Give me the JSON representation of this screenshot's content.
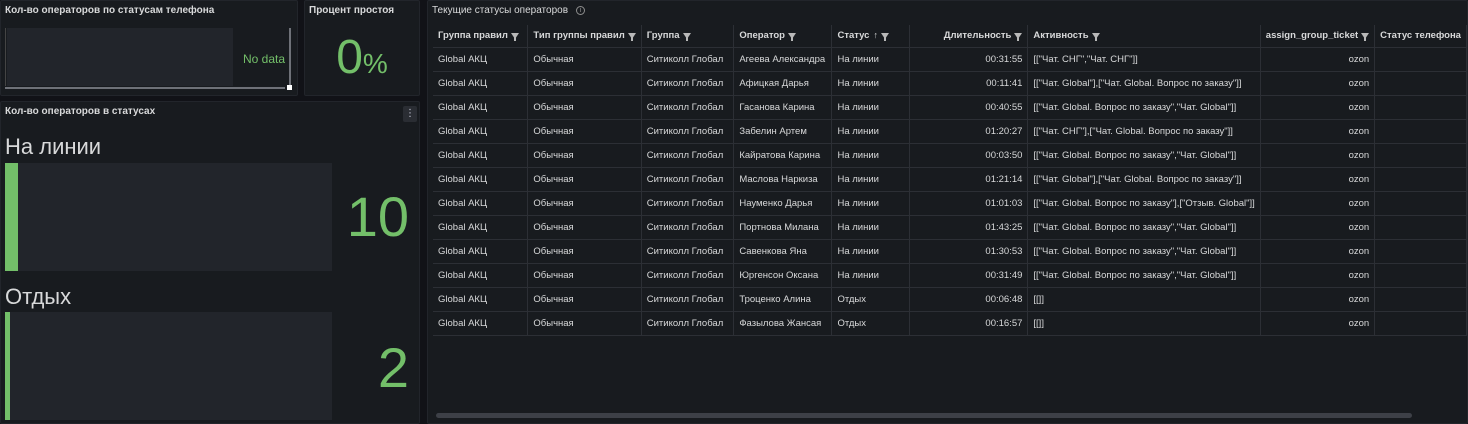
{
  "panels": {
    "phone_status": {
      "title": "Кол-во операторов по статусам телефона",
      "no_data": "No data"
    },
    "idle_percent": {
      "title": "Процент простоя",
      "value": "0",
      "unit": "%"
    },
    "status_counts": {
      "title": "Кол-во операторов в статусах",
      "menu_icon": "⋮",
      "items": [
        {
          "name": "На линии",
          "value": "10",
          "fraction": 0.04
        },
        {
          "name": "Отдых",
          "value": "2",
          "fraction": 0.006
        }
      ]
    },
    "table": {
      "title": "Текущие статусы операторов",
      "info_icon": "i",
      "sort_indicator": "↑",
      "columns": [
        "Группа правил",
        "Тип группы правил",
        "Группа",
        "Оператор",
        "Статус",
        "Длительность",
        "Активность",
        "assign_group_ticket",
        "Статус телефона"
      ],
      "rows": [
        [
          "Global АКЦ",
          "Обычная",
          "Ситиколл Глобал",
          "Агеева Александра",
          "На линии",
          "00:31:55",
          "[[\"Чат. СНГ\",\"Чат. СНГ\"]]",
          "ozon",
          ""
        ],
        [
          "Global АКЦ",
          "Обычная",
          "Ситиколл Глобал",
          "Афицкая Дарья",
          "На линии",
          "00:11:41",
          "[[\"Чат. Global\"],[\"Чат. Global. Вопрос по заказу\"]]",
          "ozon",
          ""
        ],
        [
          "Global АКЦ",
          "Обычная",
          "Ситиколл Глобал",
          "Гасанова Карина",
          "На линии",
          "00:40:55",
          "[[\"Чат. Global. Вопрос по заказу\",\"Чат. Global\"]]",
          "ozon",
          ""
        ],
        [
          "Global АКЦ",
          "Обычная",
          "Ситиколл Глобал",
          "Забелин Артем",
          "На линии",
          "01:20:27",
          "[[\"Чат. СНГ\"],[\"Чат. Global. Вопрос по заказу\"]]",
          "ozon",
          ""
        ],
        [
          "Global АКЦ",
          "Обычная",
          "Ситиколл Глобал",
          "Кайратова Карина",
          "На линии",
          "00:03:50",
          "[[\"Чат. Global. Вопрос по заказу\",\"Чат. Global\"]]",
          "ozon",
          ""
        ],
        [
          "Global АКЦ",
          "Обычная",
          "Ситиколл Глобал",
          "Маслова Наркиза",
          "На линии",
          "01:21:14",
          "[[\"Чат. Global\"],[\"Чат. Global. Вопрос по заказу\"]]",
          "ozon",
          ""
        ],
        [
          "Global АКЦ",
          "Обычная",
          "Ситиколл Глобал",
          "Науменко Дарья",
          "На линии",
          "01:01:03",
          "[[\"Чат. Global. Вопрос по заказу\"],[\"Отзыв. Global\"]]",
          "ozon",
          ""
        ],
        [
          "Global АКЦ",
          "Обычная",
          "Ситиколл Глобал",
          "Портнова Милана",
          "На линии",
          "01:43:25",
          "[[\"Чат. Global. Вопрос по заказу\",\"Чат. Global\"]]",
          "ozon",
          ""
        ],
        [
          "Global АКЦ",
          "Обычная",
          "Ситиколл Глобал",
          "Савенкова Яна",
          "На линии",
          "01:30:53",
          "[[\"Чат. Global. Вопрос по заказу\",\"Чат. Global\"]]",
          "ozon",
          ""
        ],
        [
          "Global АКЦ",
          "Обычная",
          "Ситиколл Глобал",
          "Юргенсон Оксана",
          "На линии",
          "00:31:49",
          "[[\"Чат. Global. Вопрос по заказу\",\"Чат. Global\"]]",
          "ozon",
          ""
        ],
        [
          "Global АКЦ",
          "Обычная",
          "Ситиколл Глобал",
          "Троценко Алина",
          "Отдых",
          "00:06:48",
          "[[]]",
          "ozon",
          ""
        ],
        [
          "Global АКЦ",
          "Обычная",
          "Ситиколл Глобал",
          "Фазылова Жансая",
          "Отдых",
          "00:16:57",
          "[[]]",
          "ozon",
          ""
        ]
      ]
    }
  },
  "colors": {
    "background": "#111217",
    "panel": "#181b1f",
    "accent_green": "#73bf69",
    "track": "#22252b"
  }
}
